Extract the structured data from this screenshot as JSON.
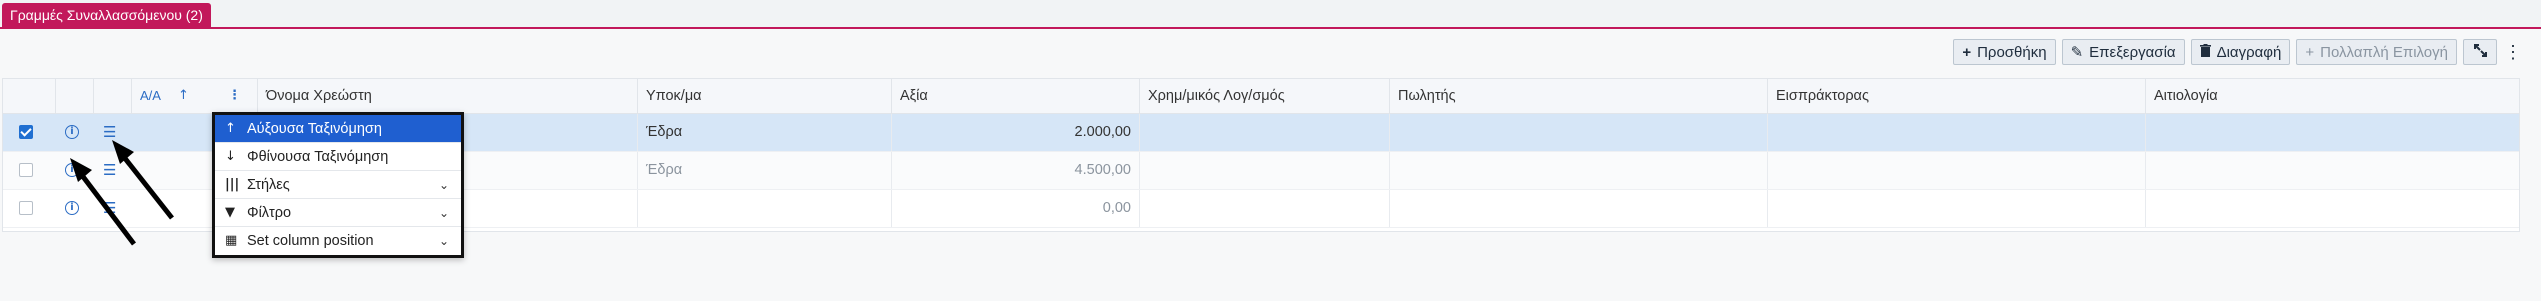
{
  "tab": {
    "label": "Γραμμές Συναλλασσόμενου (2)"
  },
  "toolbar": {
    "add": "Προσθήκη",
    "edit": "Επεξεργασία",
    "delete": "Διαγραφή",
    "multi_select": "Πολλαπλή Επιλογή"
  },
  "grid": {
    "columns": {
      "aa": "Α/Α",
      "debtor_name": "Όνομα Χρεώστη",
      "branch": "Υποκ/μα",
      "value": "Αξία",
      "account": "Χρημ/μικός Λογ/σμός",
      "seller": "Πωλητής",
      "collector": "Εισπράκτορας",
      "justification": "Αιτιολογία"
    },
    "rows": [
      {
        "selected": true,
        "branch": "Έδρα",
        "value": "2.000,00"
      },
      {
        "selected": false,
        "branch": "Έδρα",
        "value": "4.500,00"
      },
      {
        "selected": false,
        "branch": "",
        "value": "0,00"
      }
    ]
  },
  "column_menu": {
    "items": [
      {
        "label": "Αύξουσα Ταξινόμηση",
        "icon": "arrow-up-icon"
      },
      {
        "label": "Φθίνουσα Ταξινόμηση",
        "icon": "arrow-down-icon"
      },
      {
        "label": "Στήλες",
        "icon": "columns-icon"
      },
      {
        "label": "Φίλτρο",
        "icon": "filter-icon"
      },
      {
        "label": "Set column position",
        "icon": "table-icon"
      }
    ]
  },
  "colors": {
    "accent": "#c2185b",
    "selection": "#d6e6f7",
    "menu_active": "#1f5fd0"
  }
}
